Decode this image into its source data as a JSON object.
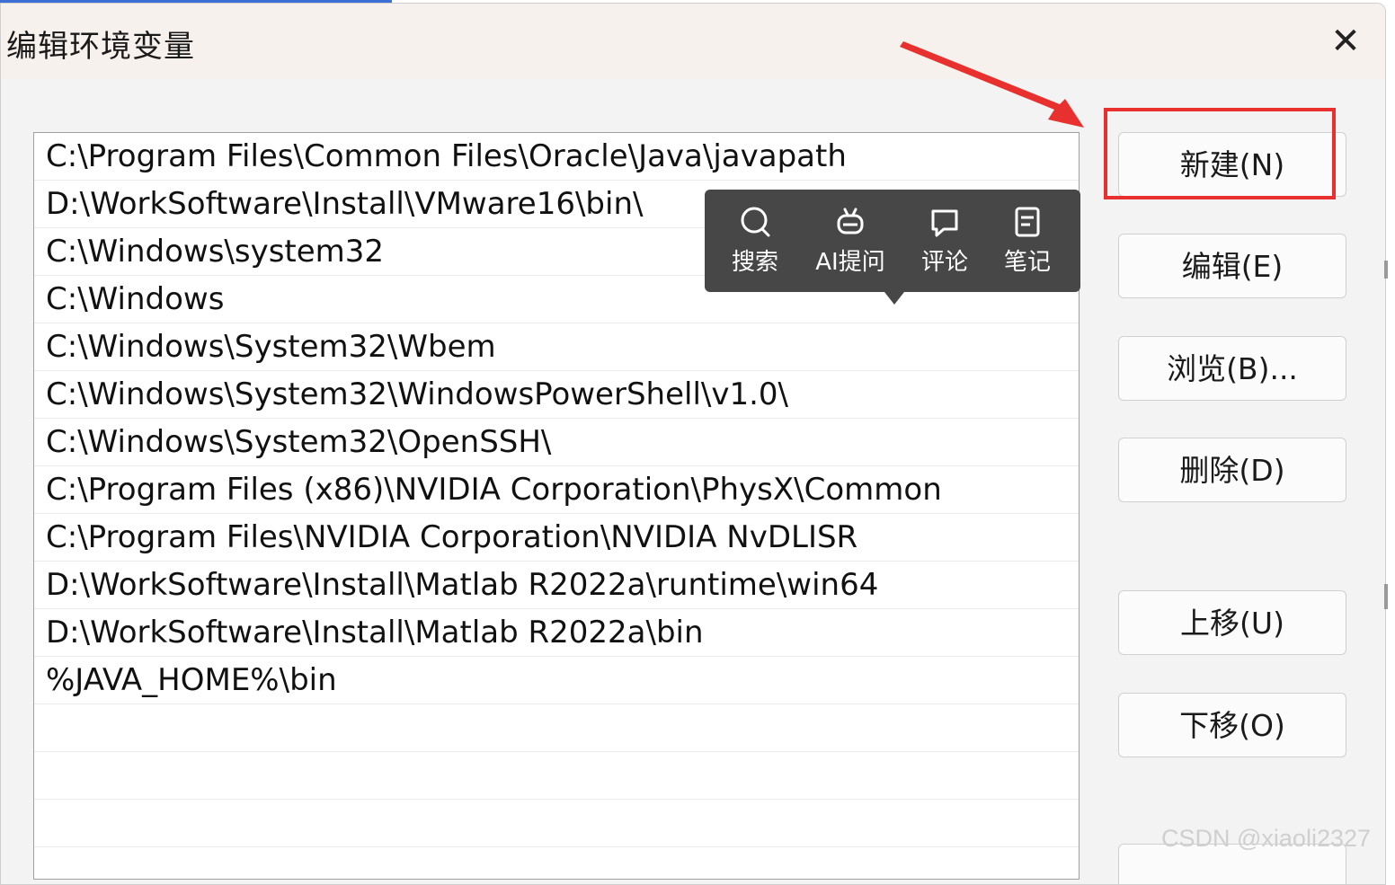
{
  "dialog": {
    "title": "编辑环境变量",
    "close_icon": "close-icon"
  },
  "paths": [
    "C:\\Program Files\\Common Files\\Oracle\\Java\\javapath",
    "D:\\WorkSoftware\\Install\\VMware16\\bin\\",
    "C:\\Windows\\system32",
    "C:\\Windows",
    "C:\\Windows\\System32\\Wbem",
    "C:\\Windows\\System32\\WindowsPowerShell\\v1.0\\",
    "C:\\Windows\\System32\\OpenSSH\\",
    "C:\\Program Files (x86)\\NVIDIA Corporation\\PhysX\\Common",
    "C:\\Program Files\\NVIDIA Corporation\\NVIDIA NvDLISR",
    "D:\\WorkSoftware\\Install\\Matlab R2022a\\runtime\\win64",
    "D:\\WorkSoftware\\Install\\Matlab R2022a\\bin",
    "%JAVA_HOME%\\bin",
    "",
    "",
    "",
    ""
  ],
  "buttons": {
    "new": "新建(N)",
    "edit": "编辑(E)",
    "browse": "浏览(B)...",
    "delete": "删除(D)",
    "move_up": "上移(U)",
    "move_down": "下移(O)"
  },
  "popup": {
    "items": [
      {
        "label": "搜索",
        "icon": "search-icon"
      },
      {
        "label": "AI提问",
        "icon": "ai-robot-icon"
      },
      {
        "label": "评论",
        "icon": "comment-icon"
      },
      {
        "label": "笔记",
        "icon": "note-icon"
      }
    ]
  },
  "annotation": {
    "highlight_color": "#e8312f"
  },
  "watermark": "CSDN @xiaoli2327"
}
